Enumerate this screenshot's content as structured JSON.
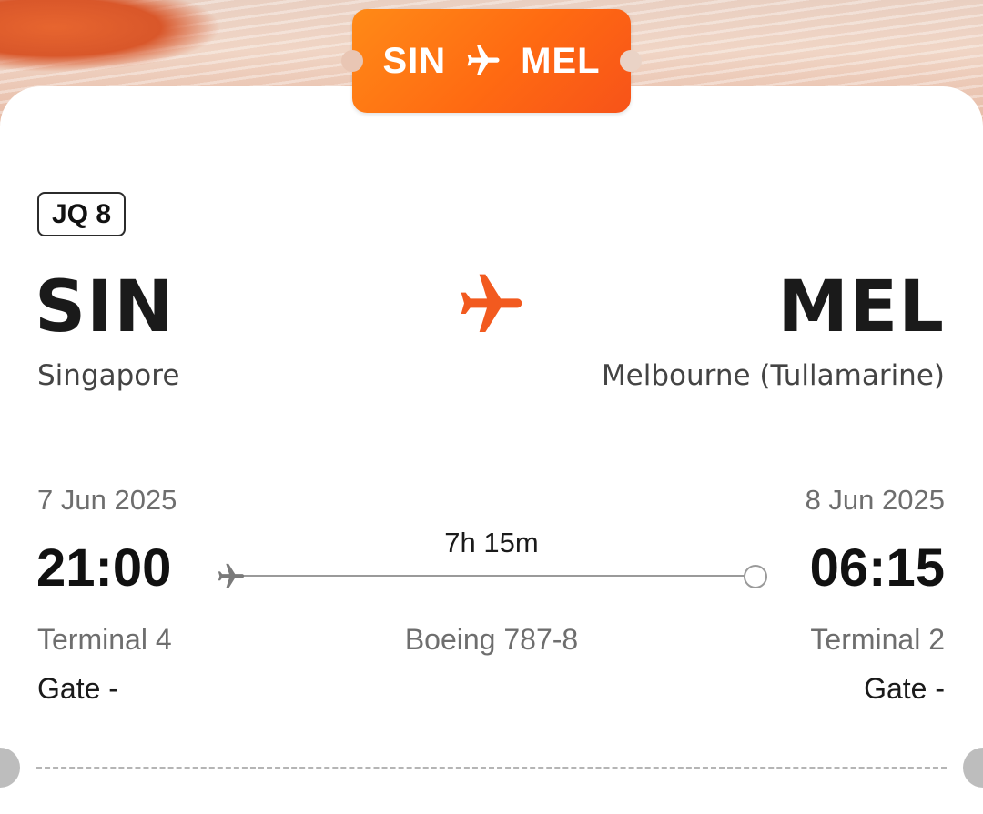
{
  "header": {
    "route_from": "SIN",
    "route_to": "MEL",
    "route_icon": "plane-icon",
    "accent_color": "#ff6a12"
  },
  "flight": {
    "number": "JQ 8",
    "duration": "7h 15m",
    "aircraft": "Boeing 787-8"
  },
  "departure": {
    "code": "SIN",
    "city": "Singapore",
    "date": "7 Jun 2025",
    "time": "21:00",
    "terminal": "Terminal 4",
    "gate": "Gate -"
  },
  "arrival": {
    "code": "MEL",
    "city": "Melbourne (Tullamarine)",
    "date": "8 Jun 2025",
    "time": "06:15",
    "terminal": "Terminal 2",
    "gate": "Gate -"
  }
}
